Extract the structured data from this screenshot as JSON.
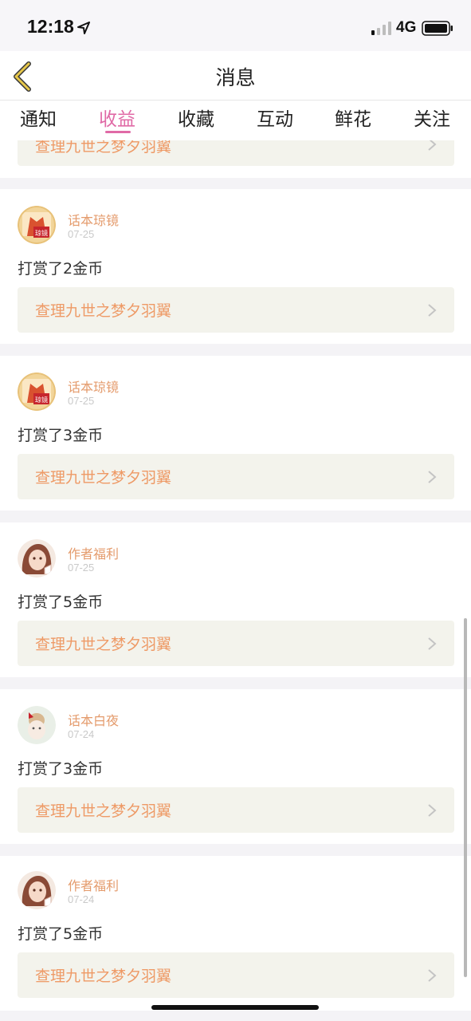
{
  "status": {
    "time": "12:18",
    "network": "4G"
  },
  "nav": {
    "title": "消息",
    "back_icon": "chevron-left-icon"
  },
  "tabs": [
    {
      "label": "通知"
    },
    {
      "label": "收益",
      "active": true
    },
    {
      "label": "收藏"
    },
    {
      "label": "互动"
    },
    {
      "label": "鲜花"
    },
    {
      "label": "关注"
    }
  ],
  "partial_card": {
    "link": "查理九世之梦夕羽翼"
  },
  "cards": [
    {
      "sender": "话本琼镜",
      "date": "07-25",
      "message": "打赏了2金币",
      "link": "查理九世之梦夕羽翼",
      "avatar": "gift-avatar"
    },
    {
      "sender": "话本琼镜",
      "date": "07-25",
      "message": "打赏了3金币",
      "link": "查理九世之梦夕羽翼",
      "avatar": "gift-avatar"
    },
    {
      "sender": "作者福利",
      "date": "07-25",
      "message": "打赏了5金币",
      "link": "查理九世之梦夕羽翼",
      "avatar": "girl-avatar"
    },
    {
      "sender": "话本白夜",
      "date": "07-24",
      "message": "打赏了3金币",
      "link": "查理九世之梦夕羽翼",
      "avatar": "doll-avatar"
    },
    {
      "sender": "作者福利",
      "date": "07-24",
      "message": "打赏了5金币",
      "link": "查理九世之梦夕羽翼",
      "avatar": "girl-avatar"
    }
  ],
  "colors": {
    "accent": "#e06aa6",
    "sender": "#e49b6c",
    "link": "#ee9a66",
    "link_bg": "#f3f3ec"
  }
}
